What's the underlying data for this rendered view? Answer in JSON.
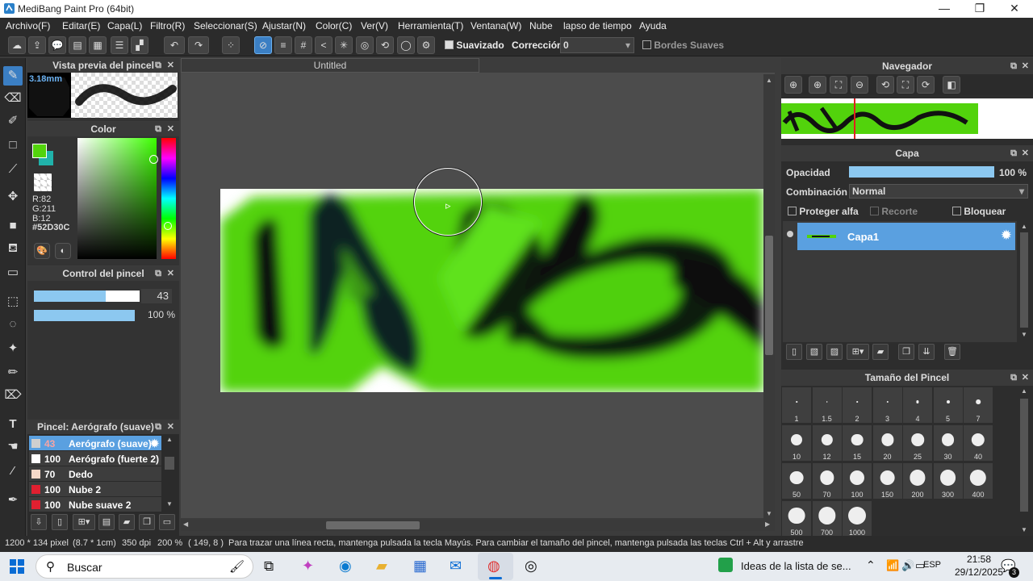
{
  "window": {
    "title": "MediBang Paint Pro (64bit)",
    "minimize": "—",
    "maximize": "❐",
    "close": "✕"
  },
  "menu": [
    "Archivo(F)",
    "Editar(E)",
    "Capa(L)",
    "Filtro(R)",
    "Seleccionar(S)",
    "Ajustar(N)",
    "Color(C)",
    "Ver(V)",
    "Herramienta(T)",
    "Ventana(W)",
    "Nube",
    "lapso de tiempo",
    "Ayuda"
  ],
  "toolbar": {
    "smoothing_label": "Suavizado",
    "correction_label": "Corrección",
    "correction_value": "0",
    "soft_edges_label": "Bordes Suaves"
  },
  "brush_preview": {
    "title": "Vista previa del pincel",
    "size": "3.18mm"
  },
  "color_panel": {
    "title": "Color",
    "r": "R:82",
    "g": "G:211",
    "b": "B:12",
    "hex": "#52D30C",
    "fg_color": "#52D30C",
    "bg_color": "#20b2aa"
  },
  "brush_control": {
    "title": "Control del pincel",
    "size_value": "43",
    "opacity_value": "100 %",
    "size_fraction": 0.68,
    "opacity_fraction": 1.0
  },
  "brush_list": {
    "title": "Pincel: Aerógrafo (suave)",
    "items": [
      {
        "value": "43",
        "name": "Aerógrafo (suave)",
        "color": "#cfcfcf",
        "selected": true
      },
      {
        "value": "100",
        "name": "Aerógrafo (fuerte 2)",
        "color": "#ffffff",
        "selected": false
      },
      {
        "value": "70",
        "name": "Dedo",
        "color": "#f5d8c8",
        "selected": false
      },
      {
        "value": "100",
        "name": "Nube 2",
        "color": "#e02030",
        "selected": false
      },
      {
        "value": "100",
        "name": "Nube suave 2",
        "color": "#e02030",
        "selected": false
      }
    ]
  },
  "document": {
    "tab_title": "Untitled"
  },
  "navigator": {
    "title": "Navegador"
  },
  "layers": {
    "title": "Capa",
    "opacity_label": "Opacidad",
    "opacity_value": "100 %",
    "opacity_fraction": 1.0,
    "blend_label": "Combinación",
    "blend_value": "Normal",
    "protect_alpha": "Proteger alfa",
    "clipping": "Recorte",
    "lock": "Bloquear",
    "items": [
      {
        "name": "Capa1",
        "selected": true
      }
    ]
  },
  "brush_size": {
    "title": "Tamaño del Pincel",
    "sizes": [
      "1",
      "1.5",
      "2",
      "3",
      "4",
      "5",
      "7",
      "10",
      "12",
      "15",
      "20",
      "25",
      "30",
      "40",
      "50",
      "70",
      "100",
      "150",
      "200",
      "300",
      "400",
      "500",
      "700",
      "1000"
    ]
  },
  "status": {
    "dimensions": "1200 * 134 pixel",
    "physical": "(8.7 * 1cm)",
    "dpi": "350 dpi",
    "zoom": "200 %",
    "coords": "( 149, 8 )",
    "hint": "Para trazar una línea recta, mantenga pulsada la tecla Mayús. Para cambiar el tamaño del pincel, mantenga pulsada las teclas Ctrl + Alt y arrastre"
  },
  "taskbar": {
    "search": "Buscar",
    "news": "Ideas de la lista de se...",
    "lang": "ESP",
    "time": "21:58",
    "date": "29/12/2025",
    "notif": "3"
  }
}
